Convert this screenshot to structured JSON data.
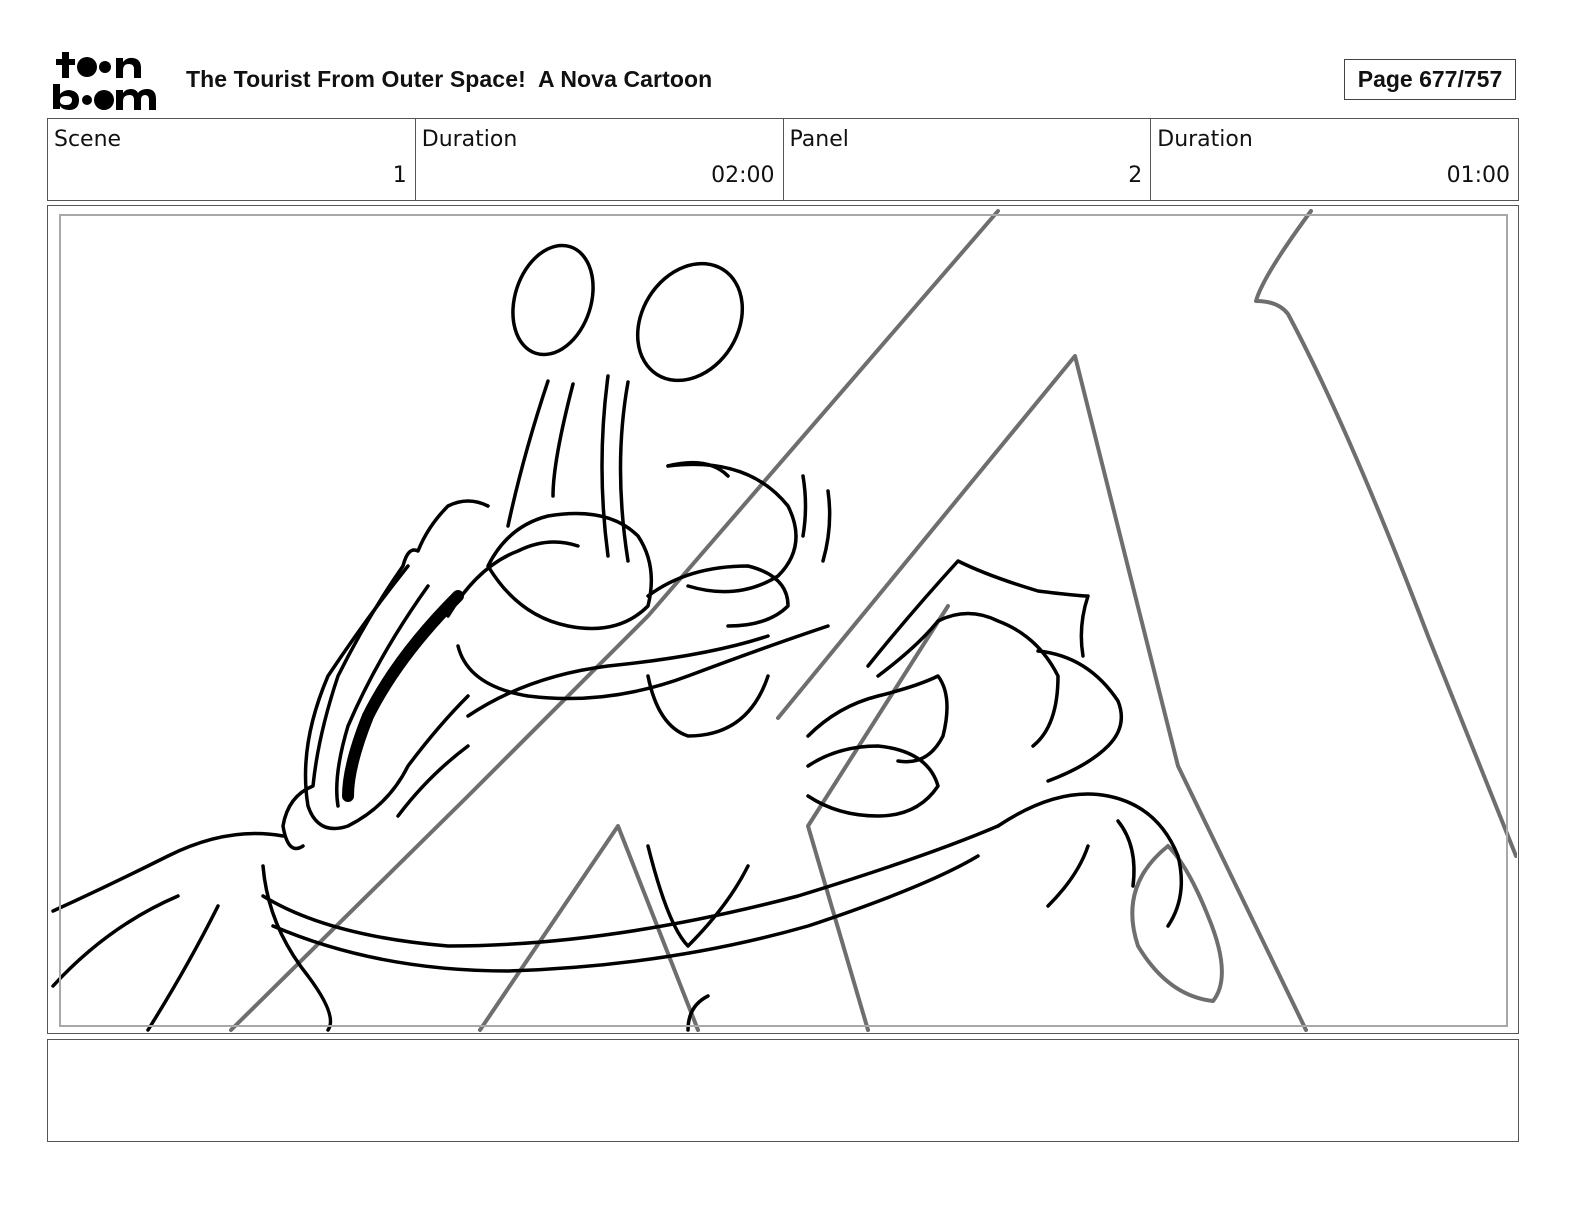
{
  "header": {
    "logo_text": "toonboom",
    "title": "The Tourist From Outer Space!  A Nova Cartoon",
    "page": "Page 677/757"
  },
  "info": {
    "scene_label": "Scene",
    "scene_value": "1",
    "scene_duration_label": "Duration",
    "scene_duration_value": "02:00",
    "panel_label": "Panel",
    "panel_value": "2",
    "panel_duration_label": "Duration",
    "panel_duration_value": "01:00"
  },
  "panel_image": {
    "icon": "storyboard-sketch-alien-character",
    "line_color": "#000000",
    "rough_color": "#6e6e6e"
  },
  "notes": {
    "text": ""
  }
}
